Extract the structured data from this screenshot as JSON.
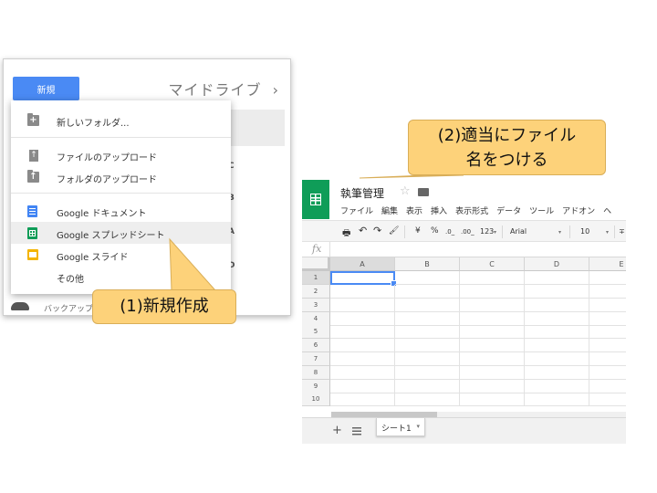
{
  "drive": {
    "new_button": "新規",
    "title": "マイドライブ",
    "title_chevron": "›",
    "bg_letters": [
      "C",
      "B",
      "A",
      "D"
    ],
    "menu": {
      "items": [
        {
          "label": "新しいフォルダ...",
          "icon": "new-folder-icon"
        },
        {
          "label": "ファイルのアップロード",
          "icon": "file-upload-icon"
        },
        {
          "label": "フォルダのアップロード",
          "icon": "folder-upload-icon"
        },
        {
          "label": "Google ドキュメント",
          "icon": "google-docs-icon"
        },
        {
          "label": "Google スプレッドシート",
          "icon": "google-sheets-icon",
          "highlighted": true
        },
        {
          "label": "Google スライド",
          "icon": "google-slides-icon"
        },
        {
          "label": "その他",
          "icon": ""
        }
      ]
    },
    "backup_label": "バックアップ"
  },
  "callouts": {
    "step1": "(1)新規作成",
    "step2_line1": "(2)適当にファイル",
    "step2_line2": "名をつける",
    "fill_color": "#fdd27a"
  },
  "sheets": {
    "doc_title": "執筆管理",
    "star": "☆",
    "menus": [
      "ファイル",
      "編集",
      "表示",
      "挿入",
      "表示形式",
      "データ",
      "ツール",
      "アドオン",
      "ヘ"
    ],
    "toolbar": {
      "print": "🖶",
      "undo": "↶",
      "redo": "↷",
      "paint_format": "🖌",
      "currency": "¥",
      "percent": "%",
      "decimal_decrease": ".0_",
      "decimal_increase": ".00_",
      "more_formats": "123",
      "font": "Arial",
      "font_size": "10",
      "more": "∓"
    },
    "fx": "fx",
    "columns": [
      "A",
      "B",
      "C",
      "D",
      "E"
    ],
    "rows": [
      "1",
      "2",
      "3",
      "4",
      "5",
      "6",
      "7",
      "8",
      "9",
      "10"
    ],
    "add_sheet": "+",
    "sheet_tab": "シート1",
    "accent_color": "#0f9d58"
  }
}
